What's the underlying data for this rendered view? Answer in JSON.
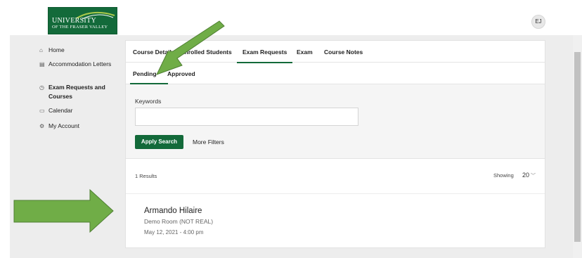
{
  "header": {
    "logo_line1": "UNIVERSITY",
    "logo_line2": "OF THE FRASER VALLEY",
    "avatar_initials": "EJ"
  },
  "sidebar": {
    "items": [
      {
        "icon": "⌂",
        "label": "Home"
      },
      {
        "icon": "▤",
        "label": "Accommodation Letters"
      },
      {
        "icon": "◷",
        "label": "Exam Requests and Courses"
      },
      {
        "icon": "▭",
        "label": "Calendar"
      },
      {
        "icon": "⚙",
        "label": "My Account"
      }
    ]
  },
  "tabs": [
    "Course Details",
    "Enrolled Students",
    "Exam Requests",
    "Exam",
    "Course Notes"
  ],
  "subtabs": [
    "Pending",
    "Approved"
  ],
  "search": {
    "keywords_label": "Keywords",
    "keywords_value": "",
    "apply_label": "Apply Search",
    "more_filters_label": "More Filters"
  },
  "results": {
    "count_text": "1 Results",
    "showing_label": "Showing",
    "page_size": "20"
  },
  "requests": [
    {
      "name": "Armando Hilaire",
      "room": "Demo Room (NOT REAL)",
      "datetime": "May 12, 2021 - 4:00 pm"
    }
  ],
  "colors": {
    "brand_green": "#136a3a",
    "annotation_arrow": "#70ad47"
  }
}
